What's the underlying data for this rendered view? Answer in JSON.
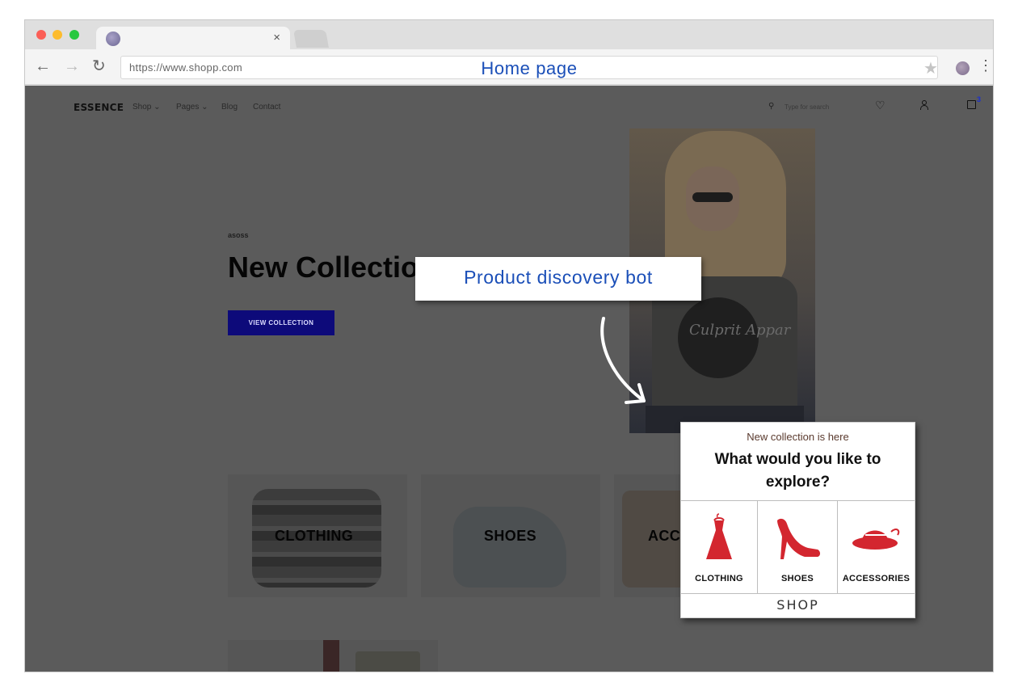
{
  "browser": {
    "url": "https://www.shopp.com",
    "page_label": "Home page",
    "tab_close": "×",
    "icons": {
      "back": "arrow-left-icon",
      "forward": "arrow-right-icon",
      "reload": "reload-icon",
      "star": "star-icon",
      "menu": "kebab-menu-icon",
      "back_glyph": "←",
      "forward_glyph": "→",
      "reload_glyph": "↻",
      "star_glyph": "★",
      "menu_glyph": "⋮"
    }
  },
  "site": {
    "logo": "ESSENCE",
    "nav": [
      "Shop ⌄",
      "Pages ⌄",
      "Blog",
      "Contact"
    ],
    "search_placeholder": "Type for search",
    "search_glyph": "⚲",
    "heart_glyph": "♡",
    "cart_count": "3"
  },
  "hero": {
    "eyebrow": "asoss",
    "title": "New Collection",
    "button": "VIEW COLLECTION",
    "shirt_text": "Culprit Appar"
  },
  "annotation": {
    "label": "Product discovery bot"
  },
  "categories": [
    {
      "label": "CLOTHING"
    },
    {
      "label": "SHOES"
    },
    {
      "label": "ACCESSORIES"
    }
  ],
  "bot": {
    "subtitle": "New collection is here",
    "question": "What would you like to explore?",
    "options": [
      {
        "label": "CLOTHING",
        "icon": "dress-icon"
      },
      {
        "label": "SHOES",
        "icon": "high-heel-icon"
      },
      {
        "label": "ACCESSORIES",
        "icon": "hat-icon"
      }
    ],
    "footer": "SHOP",
    "accent_color": "#d3262f"
  },
  "colors": {
    "annotation_text": "#1b4fb8",
    "hero_button": "#0d0a7a",
    "overlay": "#5b5b5b"
  }
}
